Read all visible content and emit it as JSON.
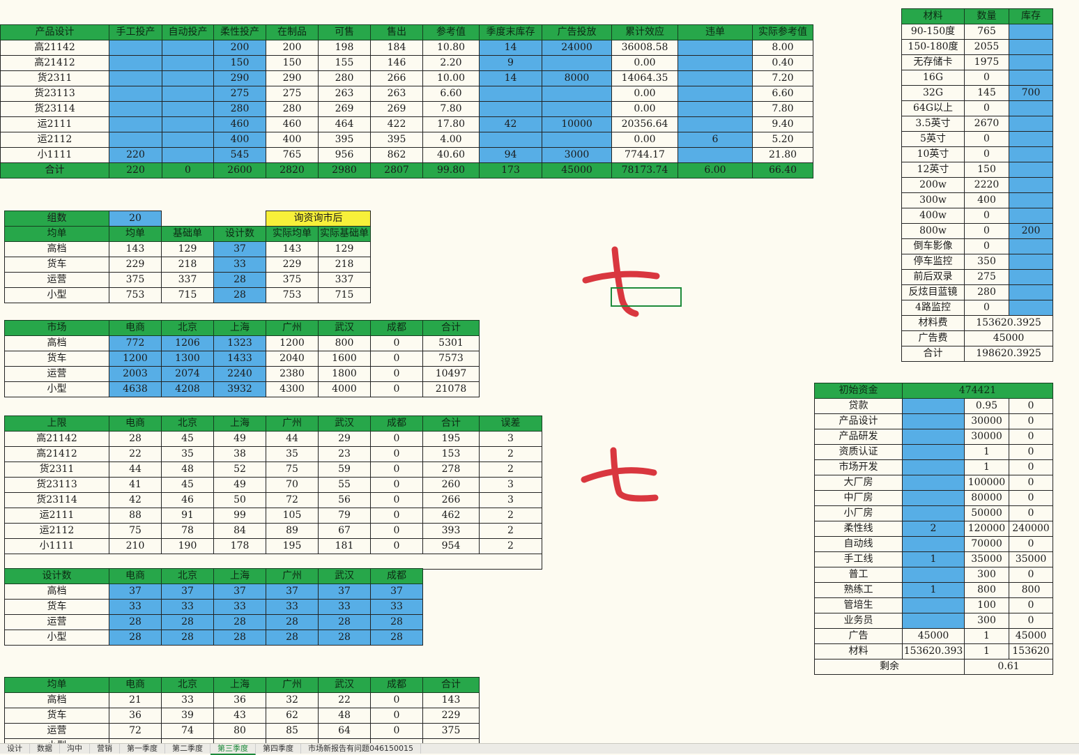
{
  "top": {
    "headers": [
      "",
      "产品设计",
      "手工投产",
      "自动投产",
      "柔性投产",
      "在制品",
      "可售",
      "售出",
      "参考值",
      "季度末库存",
      "广告投放",
      "累计效应",
      "违单",
      "实际参考值"
    ],
    "rows": [
      [
        "",
        "高21142",
        "",
        "",
        "200",
        "200",
        "198",
        "184",
        "10.80",
        "14",
        "24000",
        "36008.58",
        "",
        "8.00"
      ],
      [
        "",
        "高21412",
        "",
        "",
        "150",
        "150",
        "155",
        "146",
        "2.20",
        "9",
        "",
        "0.00",
        "",
        "0.40"
      ],
      [
        "",
        "货2311",
        "",
        "",
        "290",
        "290",
        "280",
        "266",
        "10.00",
        "14",
        "8000",
        "14064.35",
        "",
        "7.20"
      ],
      [
        "",
        "货23113",
        "",
        "",
        "275",
        "275",
        "263",
        "263",
        "6.60",
        "",
        "",
        "0.00",
        "",
        "6.60"
      ],
      [
        "",
        "货23114",
        "",
        "",
        "280",
        "280",
        "269",
        "269",
        "7.80",
        "",
        "",
        "0.00",
        "",
        "7.80"
      ],
      [
        "",
        "运2111",
        "",
        "",
        "460",
        "460",
        "464",
        "422",
        "17.80",
        "42",
        "10000",
        "20356.64",
        "",
        "9.40"
      ],
      [
        "",
        "运2112",
        "",
        "",
        "400",
        "400",
        "395",
        "395",
        "4.00",
        "",
        "",
        "0.00",
        "6",
        "5.20"
      ],
      [
        "",
        "小1111",
        "220",
        "",
        "545",
        "765",
        "956",
        "862",
        "40.60",
        "94",
        "3000",
        "7744.17",
        "",
        "21.80"
      ]
    ],
    "total": [
      "",
      "合计",
      "220",
      "0",
      "2600",
      "2820",
      "2980",
      "2807",
      "99.80",
      "173",
      "45000",
      "78173.74",
      "6.00",
      "66.40"
    ]
  },
  "groups": {
    "label": "组数",
    "value": "20",
    "yellow": "询资询市后",
    "headers": [
      "均单",
      "均单",
      "基础单",
      "设计数",
      "实际均单",
      "实际基础单"
    ],
    "rows": [
      [
        "高档",
        "143",
        "129",
        "37",
        "143",
        "129"
      ],
      [
        "货车",
        "229",
        "218",
        "33",
        "229",
        "218"
      ],
      [
        "运营",
        "375",
        "337",
        "28",
        "375",
        "337"
      ],
      [
        "小型",
        "753",
        "715",
        "28",
        "753",
        "715"
      ]
    ]
  },
  "market": {
    "headers": [
      "市场",
      "电商",
      "北京",
      "上海",
      "广州",
      "武汉",
      "成都",
      "合计"
    ],
    "rows": [
      [
        "高档",
        "772",
        "1206",
        "1323",
        "1200",
        "800",
        "0",
        "5301"
      ],
      [
        "货车",
        "1200",
        "1300",
        "1433",
        "2040",
        "1600",
        "0",
        "7573"
      ],
      [
        "运营",
        "2003",
        "2074",
        "2240",
        "2380",
        "1800",
        "0",
        "10497"
      ],
      [
        "小型",
        "4638",
        "4208",
        "3932",
        "4300",
        "4000",
        "0",
        "21078"
      ]
    ]
  },
  "limit": {
    "headers": [
      "上限",
      "电商",
      "北京",
      "上海",
      "广州",
      "武汉",
      "成都",
      "合计",
      "误差"
    ],
    "rows": [
      [
        "高21142",
        "28",
        "45",
        "49",
        "44",
        "29",
        "0",
        "195",
        "3"
      ],
      [
        "高21412",
        "22",
        "35",
        "38",
        "35",
        "23",
        "0",
        "153",
        "2"
      ],
      [
        "货2311",
        "44",
        "48",
        "52",
        "75",
        "59",
        "0",
        "278",
        "2"
      ],
      [
        "货23113",
        "41",
        "45",
        "49",
        "70",
        "55",
        "0",
        "260",
        "3"
      ],
      [
        "货23114",
        "42",
        "46",
        "50",
        "72",
        "56",
        "0",
        "266",
        "3"
      ],
      [
        "运2111",
        "88",
        "91",
        "99",
        "105",
        "79",
        "0",
        "462",
        "2"
      ],
      [
        "运2112",
        "75",
        "78",
        "84",
        "89",
        "67",
        "0",
        "393",
        "2"
      ],
      [
        "小1111",
        "210",
        "190",
        "178",
        "195",
        "181",
        "0",
        "954",
        "2"
      ]
    ]
  },
  "design": {
    "headers": [
      "设计数",
      "电商",
      "北京",
      "上海",
      "广州",
      "武汉",
      "成都"
    ],
    "rows": [
      [
        "高档",
        "37",
        "37",
        "37",
        "37",
        "37",
        "37"
      ],
      [
        "货车",
        "33",
        "33",
        "33",
        "33",
        "33",
        "33"
      ],
      [
        "运营",
        "28",
        "28",
        "28",
        "28",
        "28",
        "28"
      ],
      [
        "小型",
        "28",
        "28",
        "28",
        "28",
        "28",
        "28"
      ]
    ]
  },
  "avg": {
    "headers": [
      "均单",
      "电商",
      "北京",
      "上海",
      "广州",
      "武汉",
      "成都",
      "合计"
    ],
    "rows": [
      [
        "高档",
        "21",
        "33",
        "36",
        "32",
        "22",
        "0",
        "143"
      ],
      [
        "货车",
        "36",
        "39",
        "43",
        "62",
        "48",
        "0",
        "229"
      ],
      [
        "运营",
        "72",
        "74",
        "80",
        "85",
        "64",
        "0",
        "375"
      ],
      [
        "小型",
        "",
        "",
        "",
        "",
        "",
        "",
        ""
      ]
    ]
  },
  "materials": {
    "headers": [
      "材料",
      "数量",
      "库存"
    ],
    "rows": [
      [
        "90-150度",
        "765",
        ""
      ],
      [
        "150-180度",
        "2055",
        ""
      ],
      [
        "无存储卡",
        "1975",
        ""
      ],
      [
        "16G",
        "0",
        ""
      ],
      [
        "32G",
        "145",
        "700"
      ],
      [
        "64G以上",
        "0",
        ""
      ],
      [
        "3.5英寸",
        "2670",
        ""
      ],
      [
        "5英寸",
        "0",
        ""
      ],
      [
        "10英寸",
        "0",
        ""
      ],
      [
        "12英寸",
        "150",
        ""
      ],
      [
        "200w",
        "2220",
        ""
      ],
      [
        "300w",
        "400",
        ""
      ],
      [
        "400w",
        "0",
        ""
      ],
      [
        "800w",
        "0",
        "200"
      ],
      [
        "倒车影像",
        "0",
        ""
      ],
      [
        "停车监控",
        "350",
        ""
      ],
      [
        "前后双录",
        "275",
        ""
      ],
      [
        "反炫目蓝镜",
        "280",
        ""
      ],
      [
        "4路监控",
        "0",
        ""
      ]
    ],
    "summary": [
      [
        "材料费",
        "153620.3925"
      ],
      [
        "广告费",
        "45000"
      ],
      [
        "合计",
        "198620.3925"
      ]
    ]
  },
  "funds": {
    "title": "初始资金",
    "title_value": "474421",
    "rows": [
      [
        "贷款",
        "",
        "0.95",
        "0"
      ],
      [
        "产品设计",
        "",
        "30000",
        "0"
      ],
      [
        "产品研发",
        "",
        "30000",
        "0"
      ],
      [
        "资质认证",
        "",
        "1",
        "0"
      ],
      [
        "市场开发",
        "",
        "1",
        "0"
      ],
      [
        "大厂房",
        "",
        "100000",
        "0"
      ],
      [
        "中厂房",
        "",
        "80000",
        "0"
      ],
      [
        "小厂房",
        "",
        "50000",
        "0"
      ],
      [
        "柔性线",
        "2",
        "120000",
        "240000"
      ],
      [
        "自动线",
        "",
        "70000",
        "0"
      ],
      [
        "手工线",
        "1",
        "35000",
        "35000"
      ],
      [
        "普工",
        "",
        "300",
        "0"
      ],
      [
        "熟练工",
        "1",
        "800",
        "800"
      ],
      [
        "管培生",
        "",
        "100",
        "0"
      ],
      [
        "业务员",
        "",
        "300",
        "0"
      ],
      [
        "广告",
        "45000",
        "1",
        "45000"
      ],
      [
        "材料",
        "153620.393",
        "1",
        "153620"
      ]
    ],
    "remain_label": "剩余",
    "remain_value": "0.61"
  },
  "handwriting": {
    "char1": "七",
    "char2": "七"
  },
  "colors": {
    "header": "#27a74a",
    "blue": "#57aee6",
    "yellow": "#f7f03a",
    "ink": "#d9373f"
  },
  "tabs": [
    "设计",
    "数据",
    "沟中",
    "营销",
    "第一季度",
    "第二季度",
    "第三季度",
    "第四季度",
    "市场新报告有问题046150015"
  ],
  "active_tab": "第三季度"
}
